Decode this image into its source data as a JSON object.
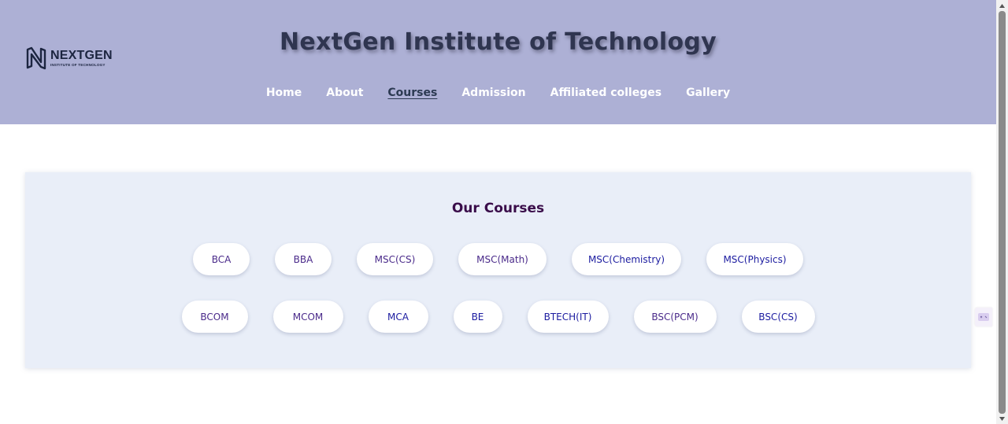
{
  "header": {
    "logo": {
      "name": "NEXTGEN",
      "tagline": "INSTITUTE OF TECHNOLOGY"
    },
    "title": "NextGen Institute of Technology",
    "nav": [
      {
        "label": "Home"
      },
      {
        "label": "About"
      },
      {
        "label": "Courses",
        "active": true
      },
      {
        "label": "Admission"
      },
      {
        "label": "Affiliated colleges"
      },
      {
        "label": "Gallery"
      }
    ]
  },
  "courses": {
    "title": "Our Courses",
    "row1": [
      "BCA",
      "BBA",
      "MSC(CS)",
      "MSC(Math)",
      "MSC(Chemistry)",
      "MSC(Physics)"
    ],
    "row2": [
      "BCOM",
      "MCOM",
      "MCA",
      "BE",
      "BTECH(IT)",
      "BSC(PCM)",
      "BSC(CS)"
    ]
  },
  "colors": {
    "header_bg": "#adb0d5",
    "panel_bg": "#e9eef8",
    "title": "#2f3550",
    "courses_title": "#3a0d4a"
  },
  "icons": {
    "logo": "nextgen-logo-icon",
    "widget": "chat-widget-icon"
  }
}
